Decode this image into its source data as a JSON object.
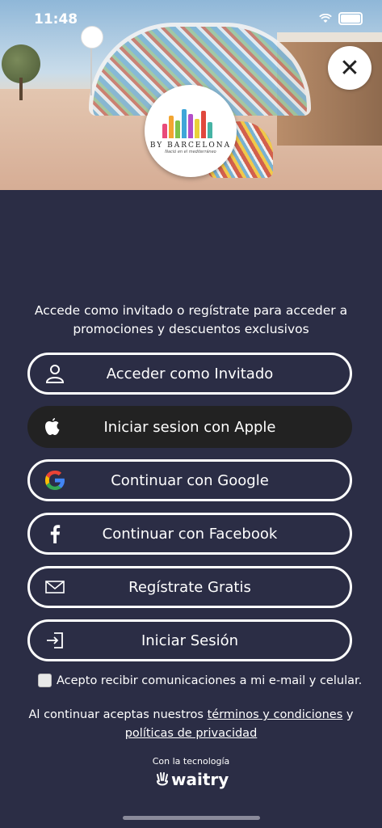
{
  "status_bar": {
    "time": "11:48"
  },
  "logo": {
    "brand": "BY BARCELONA",
    "tagline": "Nació en el mediterráneo"
  },
  "intro_text": "Accede como invitado o regístrate para acceder a promociones y descuentos exclusivos",
  "buttons": {
    "guest": "Acceder como Invitado",
    "apple": "Iniciar sesion con Apple",
    "google": "Continuar con Google",
    "facebook": "Continuar con Facebook",
    "register": "Regístrate Gratis",
    "login": "Iniciar Sesión"
  },
  "consent": {
    "label": "Acepto recibir comunicaciones a mi e-mail y celular.",
    "checked": false
  },
  "terms": {
    "prefix": "Al continuar aceptas nuestros ",
    "terms_link": "términos y condiciones",
    "middle": " y",
    "privacy_link": "políticas de privacidad"
  },
  "powered_by": {
    "label": "Con la tecnología",
    "brand": "waitry"
  },
  "colors": {
    "background": "#2b2d45",
    "apple_button": "#222222",
    "outline": "#ffffff"
  }
}
